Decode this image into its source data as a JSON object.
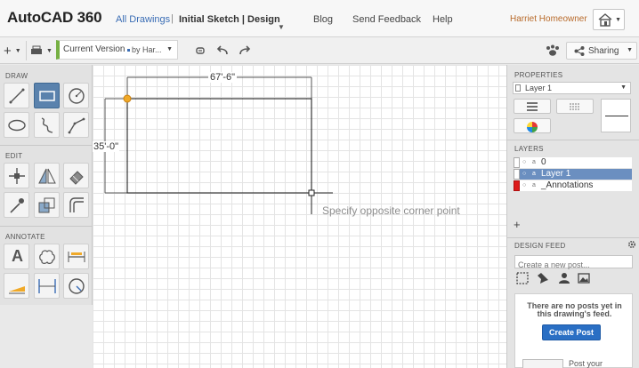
{
  "app": {
    "title": "AutoCAD 360",
    "breadcrumb_link": "All Drawings",
    "breadcrumb_separator": "|",
    "breadcrumb_current": "Initial Sketch | Design"
  },
  "topnav": {
    "blog": "Blog",
    "feedback": "Send Feedback",
    "help": "Help",
    "user": "Harriet Homeowner"
  },
  "toolbar": {
    "add_label": "+",
    "version_label": "Current Version",
    "by_label": "by Har...",
    "sharing_label": "Sharing"
  },
  "left_panel": {
    "draw_title": "DRAW",
    "edit_title": "EDIT",
    "annotate_title": "ANNOTATE",
    "annotate_text_tool": "A"
  },
  "drawing": {
    "dim_width": "67'-6\"",
    "dim_height": "35'-0\"",
    "prompt": "Specify opposite corner point"
  },
  "right_panel": {
    "properties_title": "PROPERTIES",
    "current_layer": "Layer 1",
    "layers_title": "LAYERS",
    "layers": [
      {
        "name": "0",
        "color": "#ffffff"
      },
      {
        "name": "Layer 1",
        "color": "#ffffff",
        "selected": true
      },
      {
        "name": "_Annotations",
        "color": "#dd1a1a"
      }
    ],
    "add_layer": "+",
    "feed_title": "DESIGN FEED",
    "feed_placeholder": "Create a new post...",
    "feed_empty": "There are no posts yet in this drawing's feed.",
    "create_post": "Create Post",
    "post_your": "Post your"
  },
  "colors": {
    "accent": "#2a6fc4",
    "active_tool": "#5a82ad",
    "version_bar": "#76b043",
    "user_name": "#b86a2a",
    "grip": "#f0a928"
  }
}
